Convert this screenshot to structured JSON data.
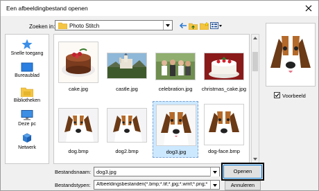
{
  "window": {
    "title": "Een afbeeldingbestand openen"
  },
  "lookin": {
    "label": "Zoeken in:",
    "value": "Photo Stitch"
  },
  "toolbar": {
    "icons": [
      "back-arrow-icon",
      "up-folder-icon",
      "new-folder-icon",
      "view-menu-icon"
    ]
  },
  "places": [
    {
      "label": "Snelle toegang",
      "icon": "star-icon"
    },
    {
      "label": "Bureaublad",
      "icon": "desktop-icon"
    },
    {
      "label": "Bibliotheken",
      "icon": "libraries-icon"
    },
    {
      "label": "Deze pc",
      "icon": "computer-icon"
    },
    {
      "label": "Netwerk",
      "icon": "network-icon"
    }
  ],
  "files": [
    {
      "name": "cake.jpg",
      "selected": false
    },
    {
      "name": "castle.jpg",
      "selected": false
    },
    {
      "name": "celebration.jpg",
      "selected": false
    },
    {
      "name": "christmas_cake.jpg",
      "selected": false
    },
    {
      "name": "dog.bmp",
      "selected": false
    },
    {
      "name": "dog2.bmp",
      "selected": false
    },
    {
      "name": "dog3.jpg",
      "selected": true
    },
    {
      "name": "dog-face.bmp",
      "selected": false
    }
  ],
  "preview": {
    "checkbox_label": "Voorbeeld",
    "checked": true
  },
  "filename": {
    "label": "Bestandsnaam:",
    "value": "dog3.jpg"
  },
  "filetype": {
    "label": "Bestandstypen:",
    "value": "Afbeeldingsbestanden(*.bmp;*.tif;*.jpg;*.wmf;*.png;*.ep"
  },
  "buttons": {
    "open": "Openen",
    "cancel": "Annuleren"
  },
  "colors": {
    "accent": "#0078d7",
    "selection": "#cce8ff",
    "folder": "#f4c542"
  }
}
